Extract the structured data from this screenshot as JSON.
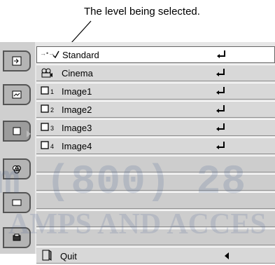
{
  "callout": {
    "text": "The level being selected."
  },
  "menu": {
    "items": [
      {
        "label": "Standard",
        "prefix": "→•→",
        "icon": "check-icon",
        "selected": true
      },
      {
        "label": "Cinema",
        "icon": "cinema-icon"
      },
      {
        "label": "Image1",
        "icon": "image-icon",
        "num": "1"
      },
      {
        "label": "Image2",
        "icon": "image-icon",
        "num": "2"
      },
      {
        "label": "Image3",
        "icon": "image-icon",
        "num": "3"
      },
      {
        "label": "Image4",
        "icon": "image-icon",
        "num": "4"
      }
    ],
    "quit": {
      "label": "Quit",
      "icon": "quit-icon"
    }
  },
  "watermark": {
    "line1": "m (800) 28",
    "line2": "AMPS AND ACCES"
  },
  "sidebar": {
    "icons": [
      "input-icon",
      "picture-adjust-icon",
      "image-select-icon",
      "color-icon",
      "screen-icon",
      "settings-icon"
    ]
  }
}
